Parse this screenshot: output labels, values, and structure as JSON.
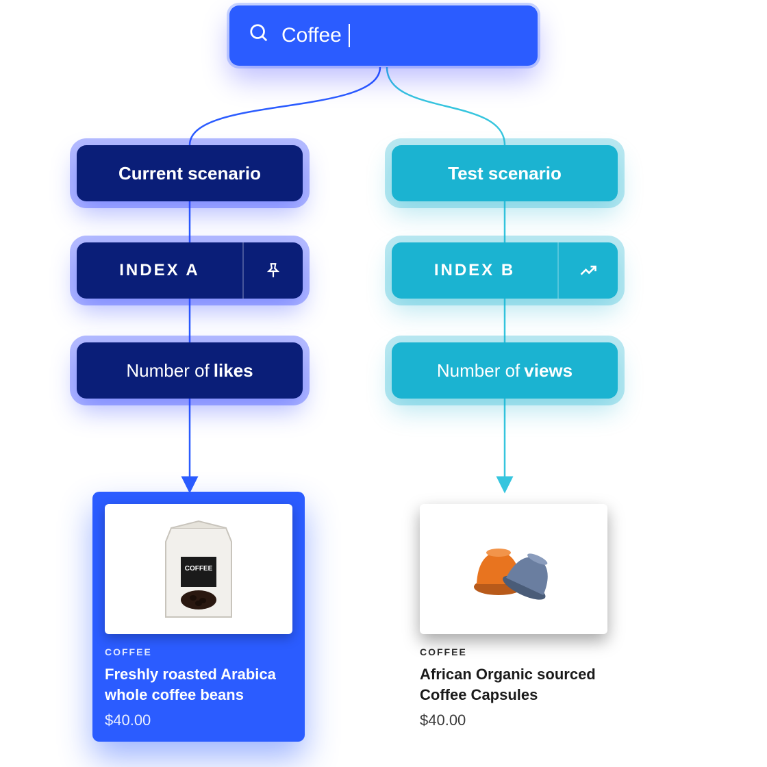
{
  "search": {
    "value": "Coffee"
  },
  "branches": {
    "a": {
      "scenario_label": "Current scenario",
      "index_label": "INDEX A",
      "metric_prefix": "Number of",
      "metric_bold": "likes",
      "icon": "pin-icon",
      "color": "#0a1e78",
      "glow": "#2b5cff",
      "product": {
        "category": "COFFEE",
        "title": "Freshly roasted Arabica whole coffee beans",
        "price": "$40.00"
      }
    },
    "b": {
      "scenario_label": "Test scenario",
      "index_label": "INDEX B",
      "metric_prefix": "Number of",
      "metric_bold": "views",
      "icon": "trend-up-icon",
      "color": "#1bb3d1",
      "glow": "#1bb3d1",
      "product": {
        "category": "COFFEE",
        "title": "African Organic sourced Coffee Capsules",
        "price": "$40.00"
      }
    }
  }
}
